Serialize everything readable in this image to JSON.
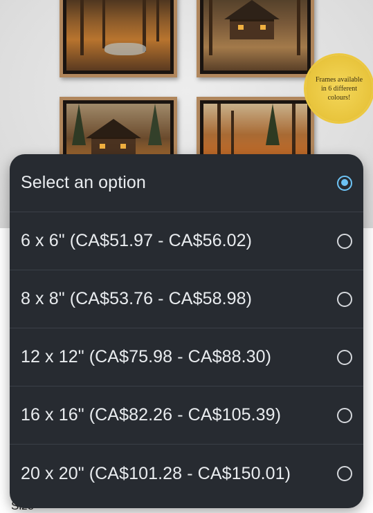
{
  "background": {
    "seal_text": "Frames available in 6 different colours!",
    "under_label": "Size"
  },
  "dropdown": {
    "options": [
      {
        "label": "Select an option",
        "selected": true
      },
      {
        "label": "6 x 6\" (CA$51.97 - CA$56.02)",
        "selected": false
      },
      {
        "label": "8 x 8\" (CA$53.76 - CA$58.98)",
        "selected": false
      },
      {
        "label": "12 x 12\" (CA$75.98 - CA$88.30)",
        "selected": false
      },
      {
        "label": "16 x 16\" (CA$82.26 - CA$105.39)",
        "selected": false
      },
      {
        "label": "20 x 20\" (CA$101.28 - CA$150.01)",
        "selected": false
      }
    ]
  },
  "colors": {
    "sheet_background": "#272b31",
    "radio_selected": "#6dc3f5",
    "seal": "#e8c43c"
  }
}
